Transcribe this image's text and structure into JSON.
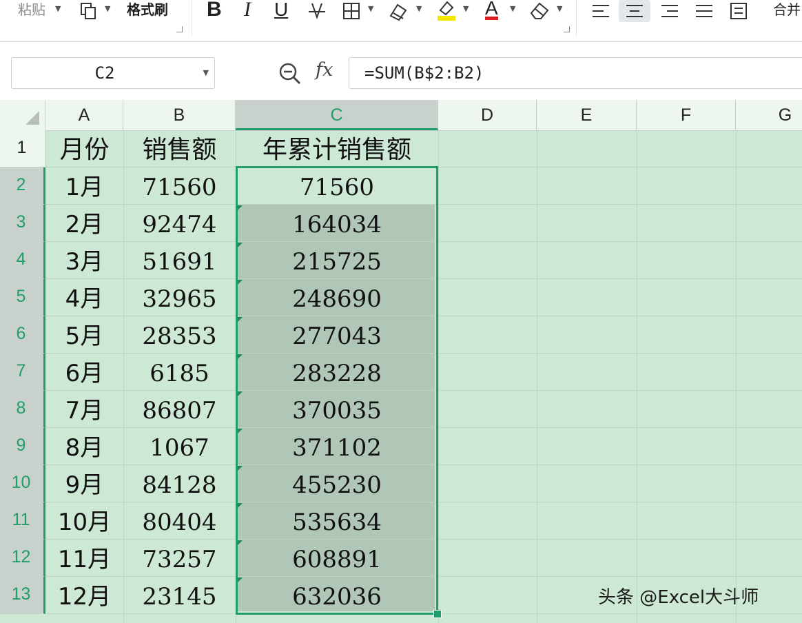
{
  "ribbon": {
    "paste_label": "粘贴",
    "format_painter_label": "格式刷",
    "bold_glyph": "B",
    "italic_glyph": "I",
    "underline_glyph": "U",
    "font_color_glyph": "A",
    "merge_label": "合并"
  },
  "formula_bar": {
    "name_box": "C2",
    "fx_label": "fx",
    "formula": "=SUM(B$2:B2)"
  },
  "grid": {
    "columns": [
      "A",
      "B",
      "C",
      "D",
      "E",
      "F",
      "G"
    ],
    "selected_column": "C",
    "rows": [
      "1",
      "2",
      "3",
      "4",
      "5",
      "6",
      "7",
      "8",
      "9",
      "10",
      "11",
      "12",
      "13"
    ],
    "selected_rows": [
      "2",
      "3",
      "4",
      "5",
      "6",
      "7",
      "8",
      "9",
      "10",
      "11",
      "12",
      "13"
    ],
    "header": {
      "a": "月份",
      "b": "销售额",
      "c": "年累计销售额"
    },
    "data": [
      {
        "a": "1月",
        "b": "71560",
        "c": "71560"
      },
      {
        "a": "2月",
        "b": "92474",
        "c": "164034"
      },
      {
        "a": "3月",
        "b": "51691",
        "c": "215725"
      },
      {
        "a": "4月",
        "b": "32965",
        "c": "248690"
      },
      {
        "a": "5月",
        "b": "28353",
        "c": "277043"
      },
      {
        "a": "6月",
        "b": "6185",
        "c": "283228"
      },
      {
        "a": "7月",
        "b": "86807",
        "c": "370035"
      },
      {
        "a": "8月",
        "b": "1067",
        "c": "371102"
      },
      {
        "a": "9月",
        "b": "84128",
        "c": "455230"
      },
      {
        "a": "10月",
        "b": "80404",
        "c": "535634"
      },
      {
        "a": "11月",
        "b": "73257",
        "c": "608891"
      },
      {
        "a": "12月",
        "b": "23145",
        "c": "632036"
      }
    ]
  },
  "watermark": "头条 @Excel大斗师",
  "colors": {
    "grid_background": "#cde8d4",
    "selection_border": "#1f9d6d",
    "selection_fill": "#b0c6b6",
    "font_color_underline": "#e02020",
    "highlight_color": "#f2e600"
  }
}
